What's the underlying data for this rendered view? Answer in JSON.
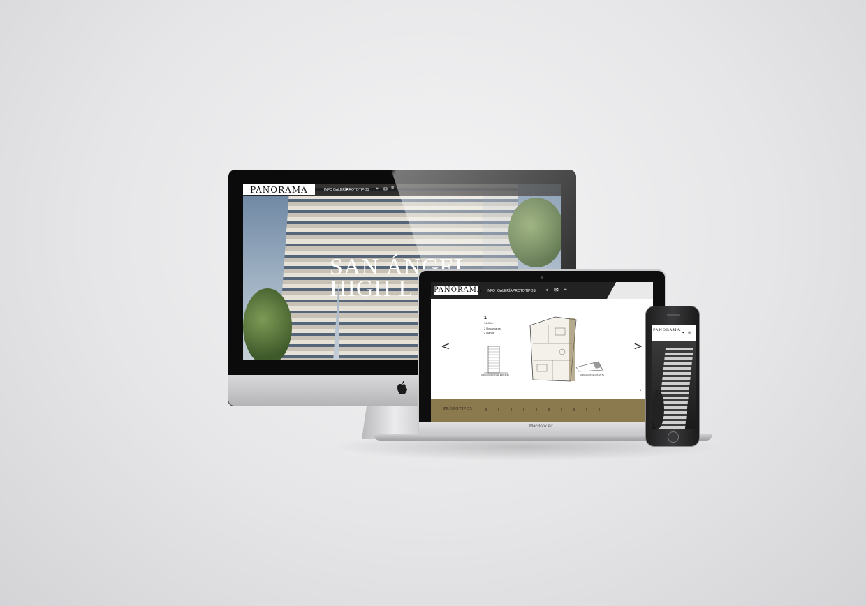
{
  "imac": {
    "logo": "PANORAMA",
    "nav": [
      "INFO",
      "GALERÍA",
      "PROTOTIPOS"
    ],
    "hero_line1": "SAN ÁNGEL",
    "hero_line2": "HIGH L",
    "icons": [
      "location-icon",
      "mail-icon",
      "menu-icon"
    ]
  },
  "macbook": {
    "logo": "PANORAMA",
    "nav": [
      "INFO",
      "GALERÍA",
      "PROTOTIPOS"
    ],
    "unit_number": "1",
    "unit_area": "74.38m²",
    "unit_details": [
      "2 Recámaras",
      "2 Baños"
    ],
    "ubicacion_edificio": "UBICACIÓN EN EL EDIFICIO",
    "ubicacion_planta": "UBICACIÓN EN PLANTA",
    "page_indicator": "1",
    "footer_label": "PROTOTIPOS",
    "brand": "MacBook Air",
    "prev": "<",
    "next": ">"
  },
  "iphone": {
    "logo": "PANORAMA"
  },
  "colors": {
    "gold": "#8b7a4e",
    "nav_dark": "#222222"
  }
}
